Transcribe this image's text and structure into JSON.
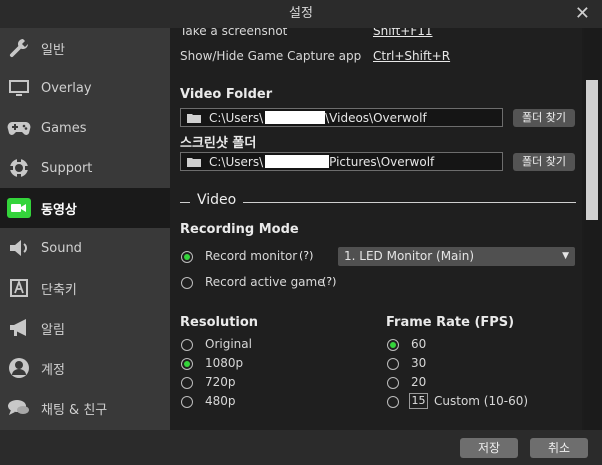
{
  "window": {
    "title": "설정"
  },
  "sidebar": {
    "items": [
      {
        "label": "일반",
        "icon": "wrench-icon"
      },
      {
        "label": "Overlay",
        "icon": "monitor-icon"
      },
      {
        "label": "Games",
        "icon": "gamepad-icon"
      },
      {
        "label": "Support",
        "icon": "support-icon"
      },
      {
        "label": "동영상",
        "icon": "video-camera-icon",
        "active": true
      },
      {
        "label": "Sound",
        "icon": "speaker-icon"
      },
      {
        "label": "단축키",
        "icon": "keyboard-key-icon"
      },
      {
        "label": "알림",
        "icon": "megaphone-icon"
      },
      {
        "label": "계정",
        "icon": "user-icon"
      },
      {
        "label": "채팅 & 친구",
        "icon": "chat-icon"
      }
    ]
  },
  "hotkeys": {
    "screenshot_label": "Take a screenshot",
    "screenshot_key": "Shift+F11",
    "toggle_label": "Show/Hide Game Capture app",
    "toggle_key": "Ctrl+Shift+R"
  },
  "video_folder": {
    "label": "Video Folder",
    "path_prefix": "C:\\Users\\",
    "path_suffix": "\\Videos\\Overwolf",
    "browse_label": "폴더 찾기"
  },
  "screenshot_folder": {
    "label": "스크린샷 폴더",
    "path_prefix": "C:\\Users\\",
    "path_suffix": "Pictures\\Overwolf",
    "browse_label": "폴더 찾기"
  },
  "video_section": {
    "heading": "Video"
  },
  "recording_mode": {
    "label": "Recording Mode",
    "option_monitor": "Record monitor",
    "option_game": "Record active game",
    "help": "(?)",
    "monitor_selected": "1. LED Monitor (Main)",
    "selected": "monitor"
  },
  "resolution": {
    "label": "Resolution",
    "options": [
      "Original",
      "1080p",
      "720p",
      "480p"
    ],
    "selected": "1080p"
  },
  "frame_rate": {
    "label": "Frame Rate (FPS)",
    "options": [
      "60",
      "30",
      "20"
    ],
    "custom_value": "15",
    "custom_label": "Custom (10-60)",
    "selected": "60"
  },
  "footer": {
    "save_label": "저장",
    "cancel_label": "취소"
  },
  "colors": {
    "accent_green": "#34d43b",
    "sidebar_bg": "#393939",
    "active_bg": "#1a1a1a"
  }
}
